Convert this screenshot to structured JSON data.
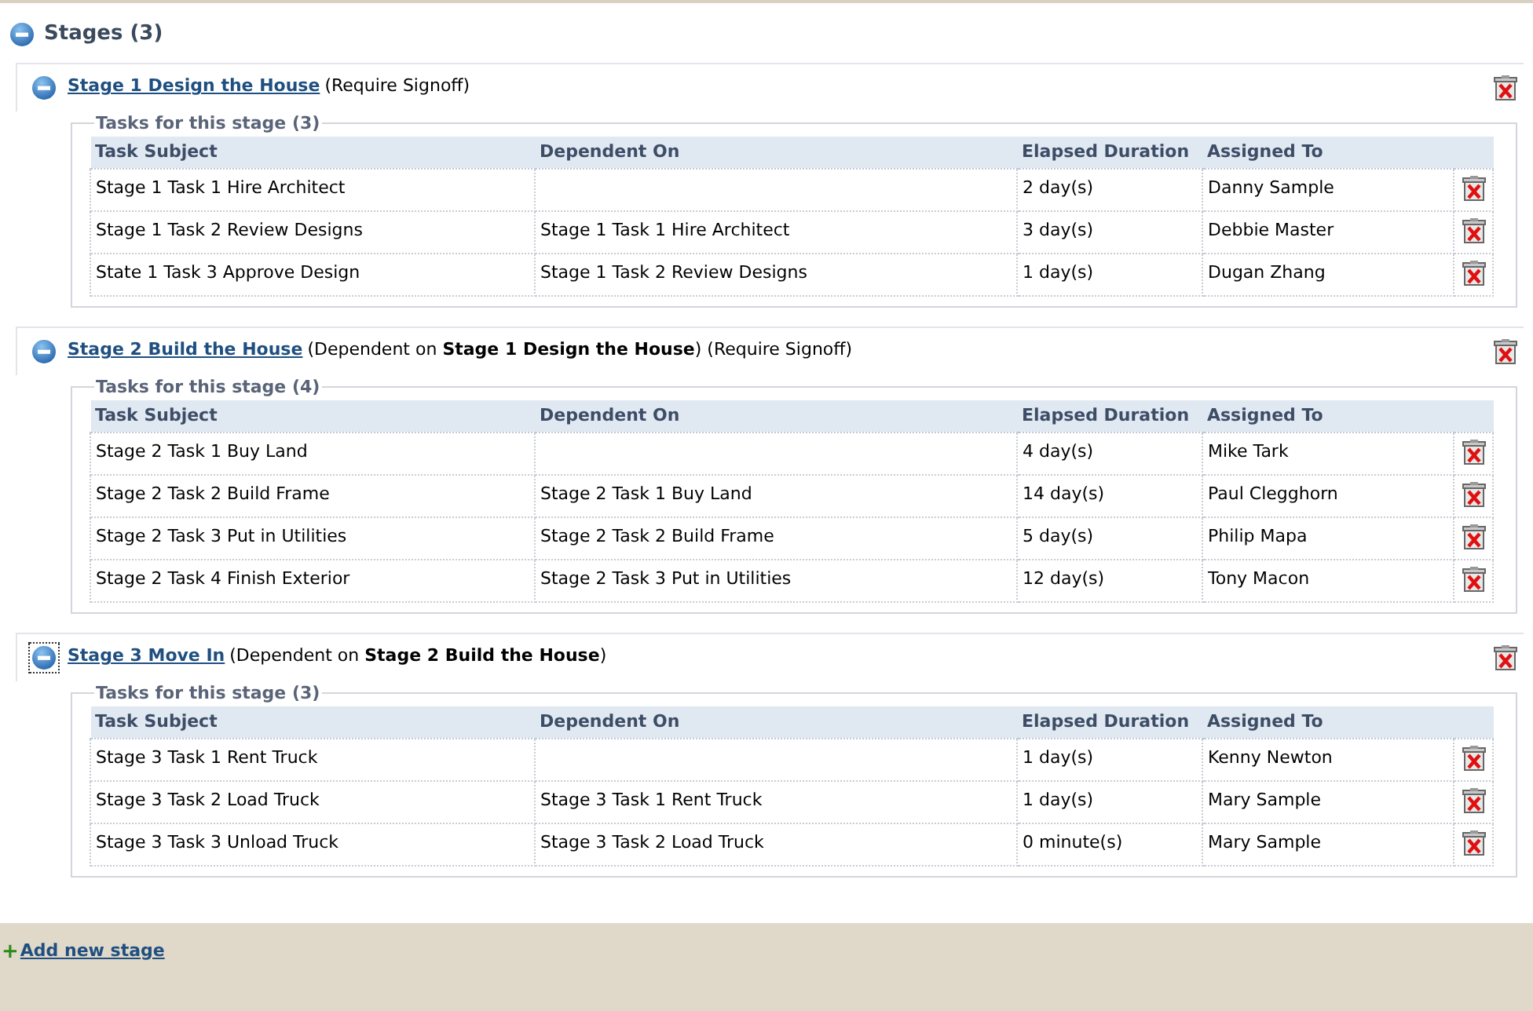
{
  "section": {
    "title": "Stages (3)",
    "expanded": true
  },
  "stages": [
    {
      "name": "Stage 1 Design the House",
      "note": " (Require Signoff)",
      "expanded": true,
      "focused": false,
      "tasks_title": "Tasks for this stage (3)",
      "columns": [
        "Task Subject",
        "Dependent On",
        "Elapsed Duration",
        "Assigned To"
      ],
      "tasks": [
        {
          "subject": "Stage 1 Task 1 Hire Architect",
          "duration": "2 day(s)",
          "assigned_to": "Danny Sample"
        },
        {
          "subject": "Stage 1 Task 2 Review Designs",
          "dependent_on": "Stage 1 Task 1 Hire Architect",
          "duration": "3 day(s)",
          "assigned_to": "Debbie Master"
        },
        {
          "subject": "State 1 Task 3 Approve Design",
          "dependent_on": "Stage 1 Task 2 Review Designs",
          "duration": "1 day(s)",
          "assigned_to": "Dugan Zhang"
        }
      ]
    },
    {
      "name": "Stage 2 Build the House",
      "note": "(Dependent on **Stage 1 Design the House**) (Require Signoff)",
      "expanded": true,
      "focused": false,
      "tasks_title": "Tasks for this stage (4)",
      "columns": [
        "Task Subject",
        "Dependent On",
        "Elapsed Duration",
        "Assigned To"
      ],
      "tasks": [
        {
          "subject": "Stage 2 Task 1 Buy Land",
          "duration": "4 day(s)",
          "assigned_to": "Mike Tark"
        },
        {
          "subject": "Stage 2 Task 2 Build Frame",
          "dependent_on": "Stage 2 Task 1 Buy Land",
          "duration": "14 day(s)",
          "assigned_to": "Paul Clegghorn"
        },
        {
          "subject": "Stage 2 Task 3 Put in Utilities",
          "dependent_on": "Stage 2 Task 2 Build Frame",
          "duration": "5 day(s)",
          "assigned_to": "Philip Mapa"
        },
        {
          "subject": "Stage 2 Task 4 Finish Exterior",
          "dependent_on": "Stage 2 Task 3 Put in Utilities",
          "duration": "12 day(s)",
          "assigned_to": "Tony Macon"
        }
      ]
    },
    {
      "name": "Stage 3 Move In",
      "note": "(Dependent on **Stage 2 Build the House**)",
      "expanded": true,
      "focused": true,
      "tasks_title": "Tasks for this stage (3)",
      "columns": [
        "Task Subject",
        "Dependent On",
        "Elapsed Duration",
        "Assigned To"
      ],
      "tasks": [
        {
          "subject": "Stage 3 Task 1 Rent Truck",
          "duration": "1 day(s)",
          "assigned_to": "Kenny Newton"
        },
        {
          "subject": "Stage 3 Task 2 Load Truck",
          "dependent_on": "Stage 3 Task 1 Rent Truck",
          "duration": "1 day(s)",
          "assigned_to": "Mary Sample"
        },
        {
          "subject": "Stage 3 Task 3 Unload Truck",
          "dependent_on": "Stage 3 Task 2 Load Truck",
          "duration": "0 minute(s)",
          "assigned_to": "Mary Sample"
        }
      ]
    }
  ],
  "add_link": {
    "icon": "+",
    "label": "Add new stage"
  }
}
